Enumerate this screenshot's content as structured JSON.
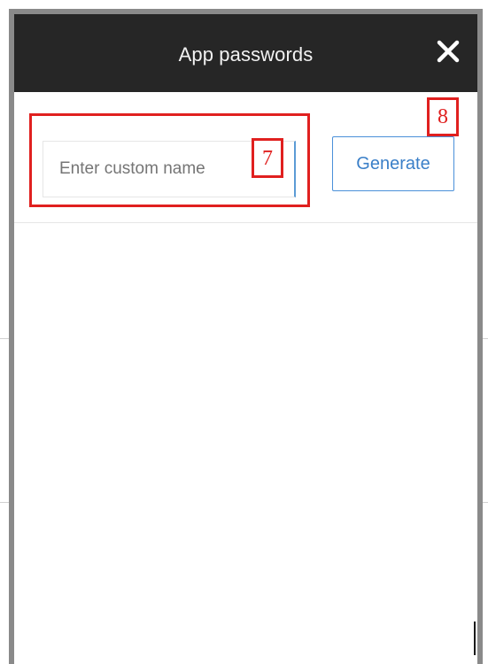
{
  "dialog": {
    "title": "App passwords",
    "close_icon": "close-icon"
  },
  "form": {
    "name_input": {
      "value": "",
      "placeholder": "Enter custom name"
    },
    "generate_label": "Generate"
  },
  "annotations": {
    "callout_7": "7",
    "callout_8": "8",
    "color": "#e0201f"
  },
  "colors": {
    "titlebar": "#262626",
    "accent": "#4a90d9",
    "frame": "#8a8a8a"
  }
}
